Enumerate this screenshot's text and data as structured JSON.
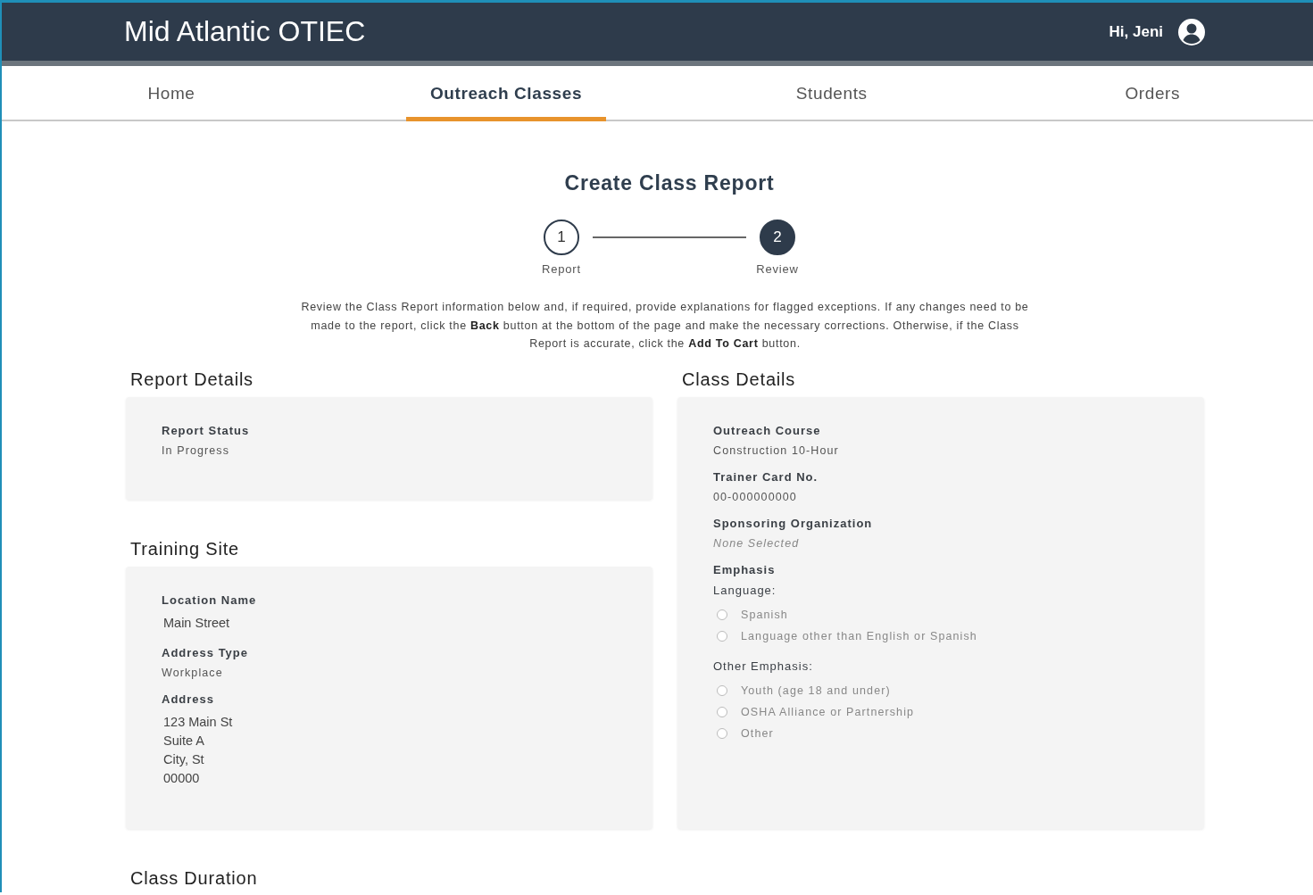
{
  "header": {
    "title": "Mid Atlantic OTIEC",
    "greeting": "Hi, Jeni"
  },
  "nav": [
    {
      "label": "Home",
      "selected": false
    },
    {
      "label": "Outreach Classes",
      "selected": true
    },
    {
      "label": "Students",
      "selected": false
    },
    {
      "label": "Orders",
      "selected": false
    }
  ],
  "page_title": "Create Class Report",
  "steps": [
    {
      "number": "1",
      "label": "Report",
      "selected": false
    },
    {
      "number": "2",
      "label": "Review",
      "selected": true
    }
  ],
  "instructions": "Review the Class Report information below and, if required, provide explanations for flagged exceptions. If any changes need to be made to the report, click the **Back** button at the bottom of the page and make the necessary corrections. Otherwise, if the Class Report is accurate, click the **Add To Cart** button.",
  "left_sections": [
    {
      "title": "Report Details",
      "fields": [
        {
          "kind": "value",
          "label": "Report Status",
          "value": "In Progress"
        }
      ]
    },
    {
      "title": "Training Site",
      "fields": [
        {
          "kind": "lines",
          "label": "Location Name",
          "lines": [
            "Main Street"
          ]
        },
        {
          "kind": "value",
          "label": "Address Type",
          "value": "Workplace"
        },
        {
          "kind": "lines",
          "label": "Address",
          "lines": [
            "123 Main St",
            "Suite A",
            "City, St",
            "00000"
          ]
        }
      ]
    }
  ],
  "right_sections": [
    {
      "title": "Class Details",
      "fields": [
        {
          "kind": "value",
          "label": "Outreach Course",
          "value": "Construction 10-Hour"
        },
        {
          "kind": "value",
          "label": "Trainer Card No.",
          "value": "00-000000000"
        },
        {
          "kind": "none",
          "label": "Sponsoring Organization",
          "value": "None Selected"
        },
        {
          "kind": "options",
          "label": "Emphasis",
          "groups": [
            {
              "title": "Language:",
              "options": [
                {
                  "label": "Spanish",
                  "checked": false
                },
                {
                  "label": "Language other than English or Spanish",
                  "checked": false
                }
              ]
            },
            {
              "title": "Other Emphasis:",
              "options": [
                {
                  "label": "Youth (age 18 and under)",
                  "checked": false
                },
                {
                  "label": "OSHA Alliance or Partnership",
                  "checked": false
                },
                {
                  "label": "Other",
                  "checked": false
                }
              ]
            }
          ]
        }
      ]
    }
  ],
  "bottom_section": {
    "title": "Class Duration"
  }
}
